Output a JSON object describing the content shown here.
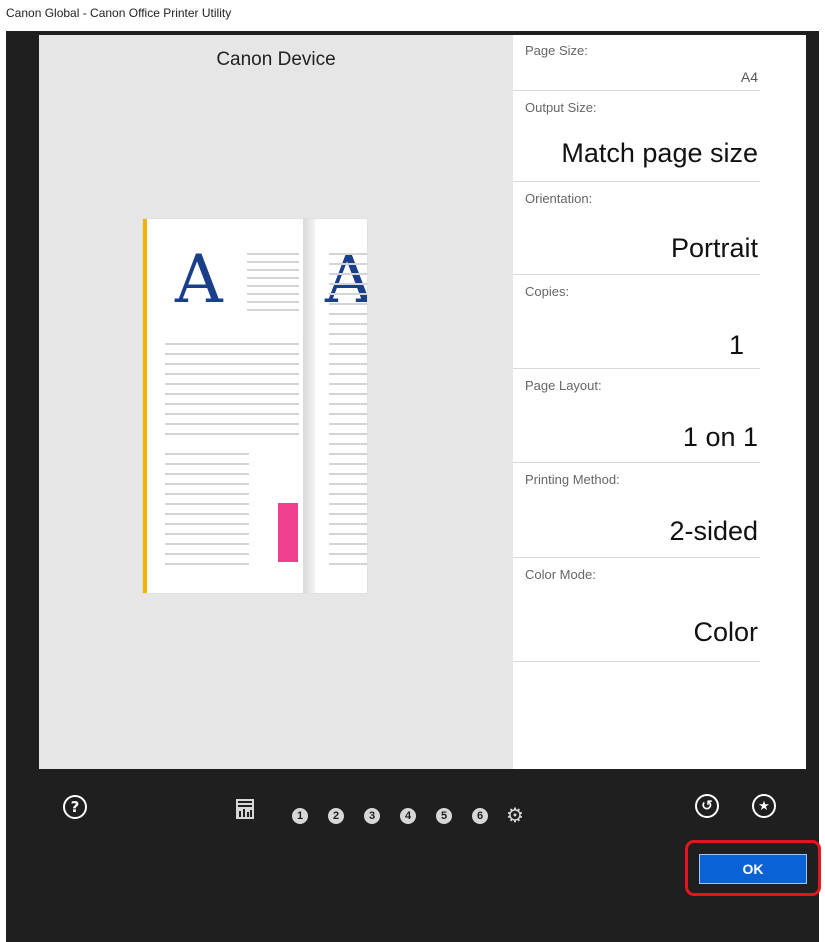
{
  "window": {
    "title": "Canon Global - Canon Office Printer Utility"
  },
  "preview": {
    "title": "Canon Device",
    "glyph_left": "A",
    "glyph_right": "A"
  },
  "settings": [
    {
      "label": "Page Size:",
      "value": "A4"
    },
    {
      "label": "Output Size:",
      "value": "Match page size"
    },
    {
      "label": "Orientation:",
      "value": "Portrait"
    },
    {
      "label": "Copies:",
      "value": "1"
    },
    {
      "label": "Page Layout:",
      "value": "1 on 1"
    },
    {
      "label": "Printing Method:",
      "value": "2-sided"
    },
    {
      "label": "Color Mode:",
      "value": "Color"
    }
  ],
  "toolbar": {
    "help_glyph": "?",
    "presets": [
      "1",
      "2",
      "3",
      "4",
      "5",
      "6"
    ],
    "gear_glyph": "⚙",
    "favorite_glyph": "★",
    "reset_glyph": "↺"
  },
  "actions": {
    "ok_label": "OK"
  },
  "colors": {
    "app_bg": "#1f1f1f",
    "preview_bg": "#e6e6e6",
    "ok_bg": "#0b62d6",
    "highlight": "#e3161e",
    "doc_accent": "#f0b400",
    "doc_pink": "#ef3f8f",
    "glyph_blue": "#1a3f8a"
  }
}
